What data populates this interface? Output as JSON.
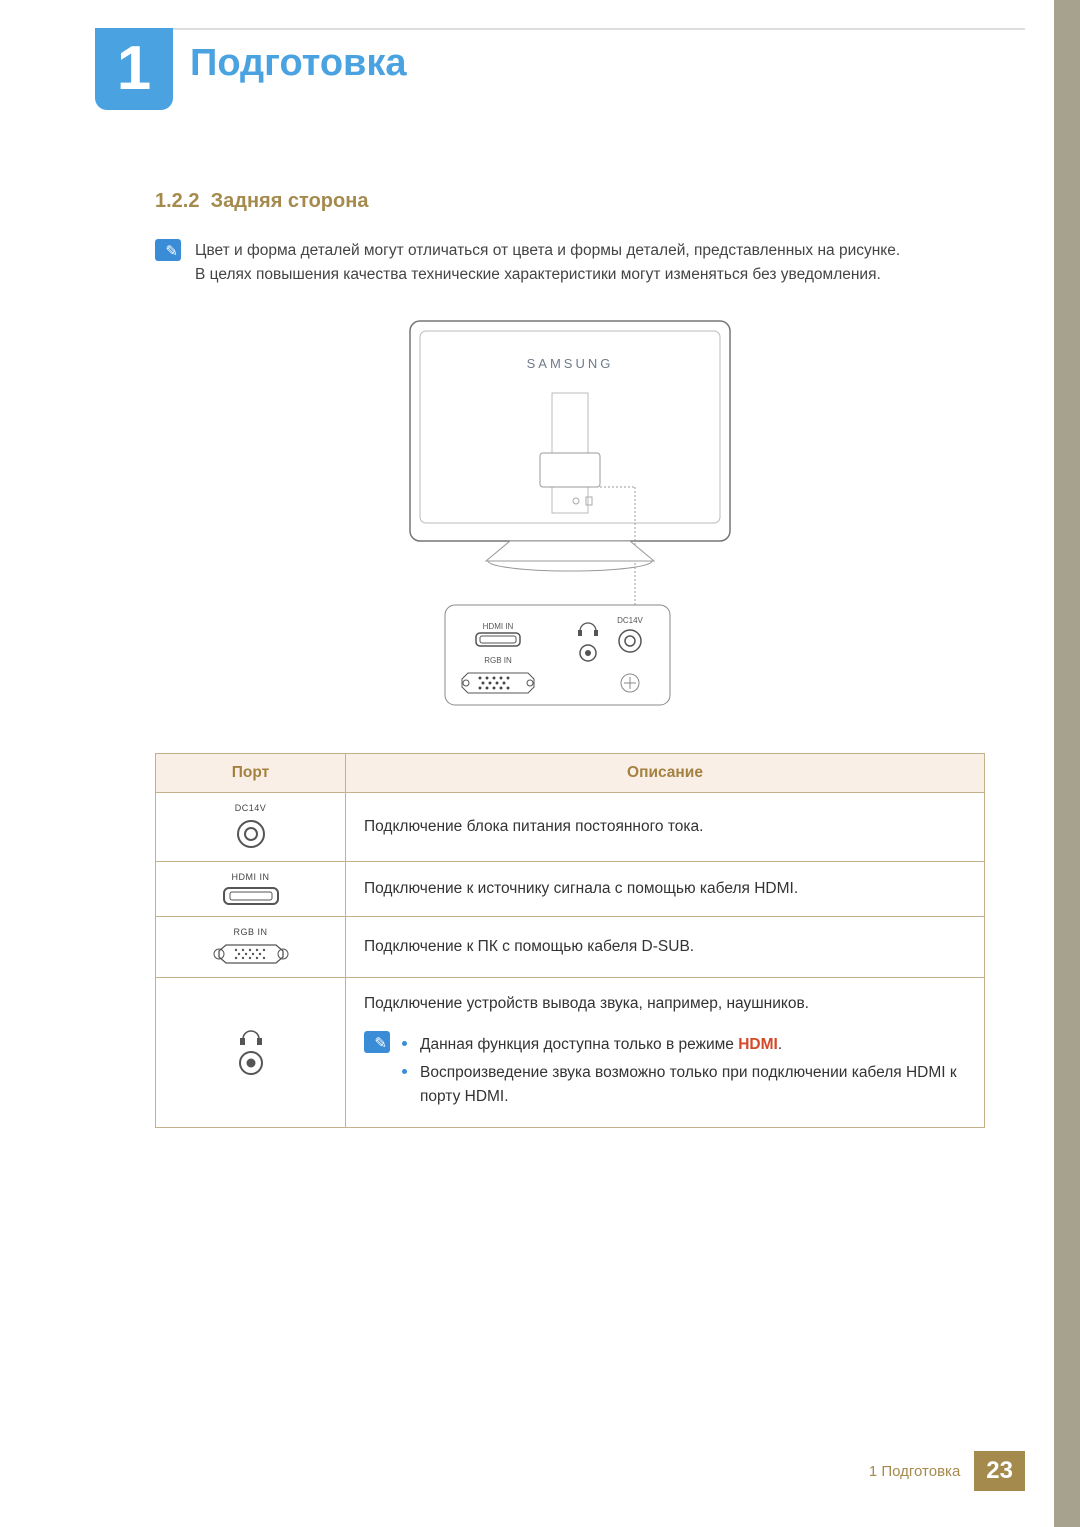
{
  "chapter": {
    "number": "1",
    "title": "Подготовка"
  },
  "section": {
    "number": "1.2.2",
    "title": "Задняя сторона"
  },
  "note": {
    "line1": "Цвет и форма деталей могут отличаться от цвета и формы деталей, представленных на рисунке.",
    "line2": "В целях повышения качества технические характеристики могут изменяться без уведомления."
  },
  "figure": {
    "brand": "SAMSUNG",
    "callout_labels": {
      "hdmi_in": "HDMI IN",
      "rgb_in": "RGB IN",
      "dc14v": "DC14V"
    }
  },
  "table": {
    "headers": {
      "port": "Порт",
      "desc": "Описание"
    },
    "rows": [
      {
        "port_label": "DC14V",
        "desc": "Подключение блока питания постоянного тока."
      },
      {
        "port_label": "HDMI IN",
        "desc": "Подключение к источнику сигнала с помощью кабеля HDMI."
      },
      {
        "port_label": "RGB IN",
        "desc": "Подключение к ПК с помощью кабеля D-SUB."
      },
      {
        "port_label": "",
        "desc": "Подключение устройств вывода звука, например, наушников.",
        "bullets": [
          {
            "pre": "Данная функция доступна только в режиме ",
            "em": "HDMI",
            "post": "."
          },
          {
            "text": "Воспроизведение звука возможно только при подключении кабеля HDMI к порту HDMI."
          }
        ]
      }
    ]
  },
  "footer": {
    "crumb": "1 Подготовка",
    "page": "23"
  }
}
